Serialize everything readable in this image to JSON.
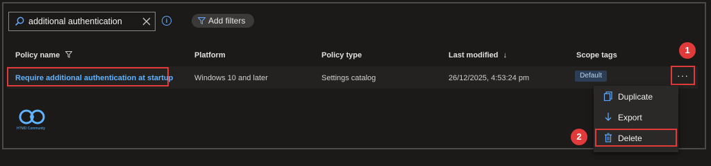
{
  "search": {
    "value": "additional authentication",
    "placeholder": "Search"
  },
  "toolbar": {
    "add_filters_label": "Add filters"
  },
  "table": {
    "columns": [
      "Policy name",
      "Platform",
      "Policy type",
      "Last modified",
      "Scope tags"
    ],
    "rows": [
      {
        "policy_name": "Require additional authentication at startup",
        "platform": "Windows 10 and later",
        "policy_type": "Settings catalog",
        "last_modified": "26/12/2025, 4:53:24 pm",
        "scope_tag": "Default"
      }
    ]
  },
  "context_menu": {
    "items": [
      {
        "label": "Duplicate",
        "icon": "copy-icon"
      },
      {
        "label": "Export",
        "icon": "download-icon"
      },
      {
        "label": "Delete",
        "icon": "trash-icon"
      }
    ]
  },
  "markers": {
    "one": "1",
    "two": "2"
  },
  "watermark": {
    "text": "HTMD Community"
  },
  "colors": {
    "accent": "#5fb3ff",
    "highlight": "#e03a3a",
    "background": "#1b1a19"
  }
}
